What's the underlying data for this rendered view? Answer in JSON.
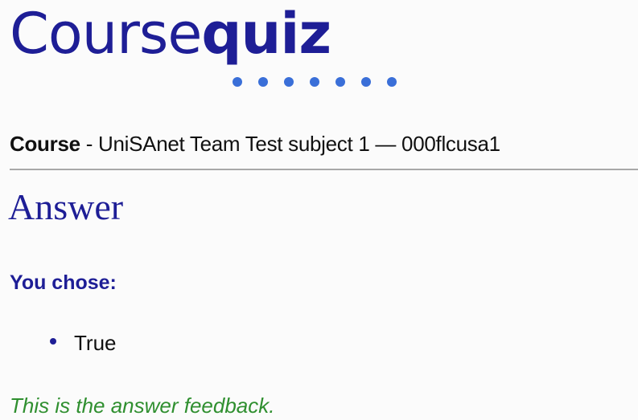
{
  "logo": {
    "light": "Course",
    "bold": "quiz"
  },
  "course": {
    "label": "Course",
    "separator": " - ",
    "name": "UniSAnet Team Test subject 1 — 000flcusa1"
  },
  "answer": {
    "heading": "Answer",
    "chosen_label": "You chose:",
    "choices": [
      "True"
    ],
    "feedback": "This is the answer feedback."
  },
  "colors": {
    "brand": "#1e1e96",
    "dots": "#3a6fd8",
    "feedback": "#2f8f2f",
    "divider": "#a8a8a8"
  }
}
